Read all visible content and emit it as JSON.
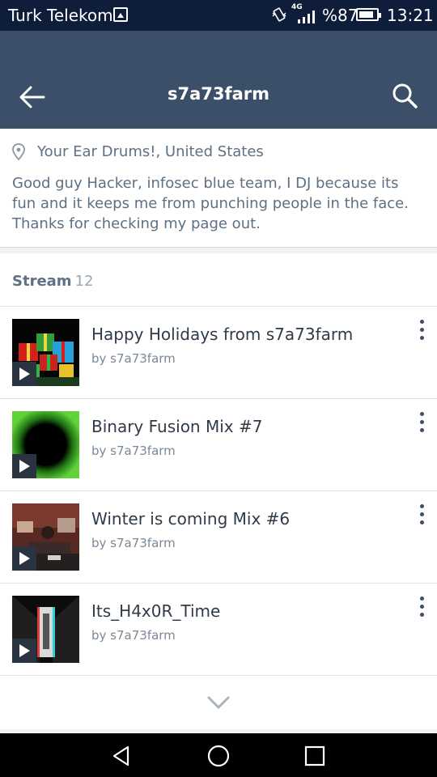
{
  "status_bar": {
    "carrier": "Turk Telekom",
    "network": "4G",
    "battery": "%87",
    "battery_level": 0.87,
    "time": "13:21"
  },
  "app_bar": {
    "title": "s7a73farm"
  },
  "profile": {
    "location": "Your Ear Drums!, United States",
    "bio": "Good guy Hacker, infosec blue team, I DJ because its fun and it keeps me from punching people in the face. Thanks for checking my page out."
  },
  "stream": {
    "label": "Stream",
    "count": "12",
    "tracks": [
      {
        "title": "Happy Holidays from s7a73farm",
        "artist": "by s7a73farm"
      },
      {
        "title": "Binary Fusion Mix #7",
        "artist": "by s7a73farm"
      },
      {
        "title": "Winter is coming Mix #6",
        "artist": "by s7a73farm"
      },
      {
        "title": "Its_H4x0R_Time",
        "artist": "by s7a73farm"
      }
    ]
  },
  "colors": {
    "app_bar": "#3b5068",
    "status_bar": "#0e1d3a",
    "text_secondary": "#5d7084"
  },
  "icons": {
    "back": "arrow-left-icon",
    "search": "search-icon",
    "location": "location-pin-icon",
    "play": "play-icon",
    "more": "more-vertical-icon",
    "expand": "chevron-down-icon"
  }
}
